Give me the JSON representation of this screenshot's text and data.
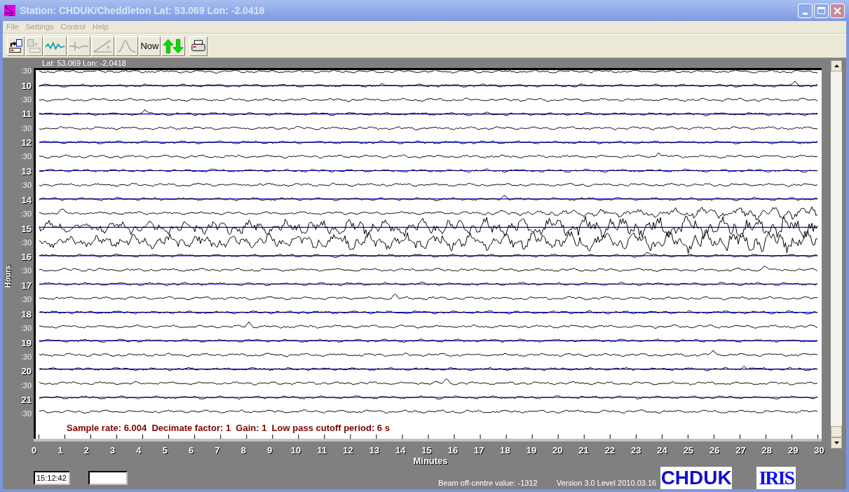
{
  "window": {
    "title": "Station: CHDUK/Cheddleton Lat: 53.069 Lon: -2.0418"
  },
  "menu": [
    {
      "label": "File",
      "disabled": true
    },
    {
      "label": "Settings",
      "disabled": true
    },
    {
      "label": "Control",
      "disabled": true
    },
    {
      "label": "Help",
      "disabled": true
    }
  ],
  "toolbar": [
    {
      "kind": "export",
      "disabled": false
    },
    {
      "kind": "copy",
      "disabled": true
    },
    {
      "kind": "wave",
      "disabled": false
    },
    {
      "kind": "step",
      "disabled": true
    },
    {
      "kind": "ramp",
      "disabled": true
    },
    {
      "kind": "peak",
      "disabled": true
    },
    {
      "kind": "text",
      "label": "Now",
      "disabled": false
    },
    {
      "kind": "arrows",
      "disabled": false
    },
    {
      "kind": "print",
      "disabled": false
    }
  ],
  "location": "Lat: 53.069 Lon: -2.0418",
  "y_axis": {
    "title": "Hours",
    "rows": [
      {
        "label": ":30",
        "kind": "half"
      },
      {
        "label": "10",
        "kind": "hour"
      },
      {
        "label": ":30",
        "kind": "half"
      },
      {
        "label": "11",
        "kind": "hour"
      },
      {
        "label": ":30",
        "kind": "half"
      },
      {
        "label": "12",
        "kind": "hour"
      },
      {
        "label": ":30",
        "kind": "half"
      },
      {
        "label": "13",
        "kind": "hour"
      },
      {
        "label": ":30",
        "kind": "half"
      },
      {
        "label": "14",
        "kind": "hour"
      },
      {
        "label": ":30",
        "kind": "half"
      },
      {
        "label": "15",
        "kind": "hour"
      },
      {
        "label": ":30",
        "kind": "half"
      },
      {
        "label": "16",
        "kind": "hour"
      },
      {
        "label": ":30",
        "kind": "half"
      },
      {
        "label": "17",
        "kind": "hour"
      },
      {
        "label": ":30",
        "kind": "half"
      },
      {
        "label": "18",
        "kind": "hour"
      },
      {
        "label": ":30",
        "kind": "half"
      },
      {
        "label": "19",
        "kind": "hour"
      },
      {
        "label": ":30",
        "kind": "half"
      },
      {
        "label": "20",
        "kind": "hour"
      },
      {
        "label": ":30",
        "kind": "half"
      },
      {
        "label": "21",
        "kind": "hour"
      },
      {
        "label": ":30",
        "kind": "half"
      }
    ]
  },
  "info": "Sample rate: 6.004  Decimate factor: 1  Gain: 1  Low pass cutoff period: 6 s",
  "x_axis": {
    "title": "Minutes",
    "labels": [
      "0",
      "1",
      "2",
      "3",
      "4",
      "5",
      "6",
      "7",
      "8",
      "9",
      "10",
      "11",
      "12",
      "13",
      "14",
      "15",
      "16",
      "17",
      "18",
      "19",
      "20",
      "21",
      "22",
      "23",
      "24",
      "25",
      "26",
      "27",
      "28",
      "29",
      "30"
    ]
  },
  "footer": {
    "time": "15:12:42",
    "beam": "Beam off-centre value: -1312",
    "version": "Version 3.0 Level 2010.03.16",
    "station_logo": "CHDUK",
    "network_logo": "IRIS"
  }
}
